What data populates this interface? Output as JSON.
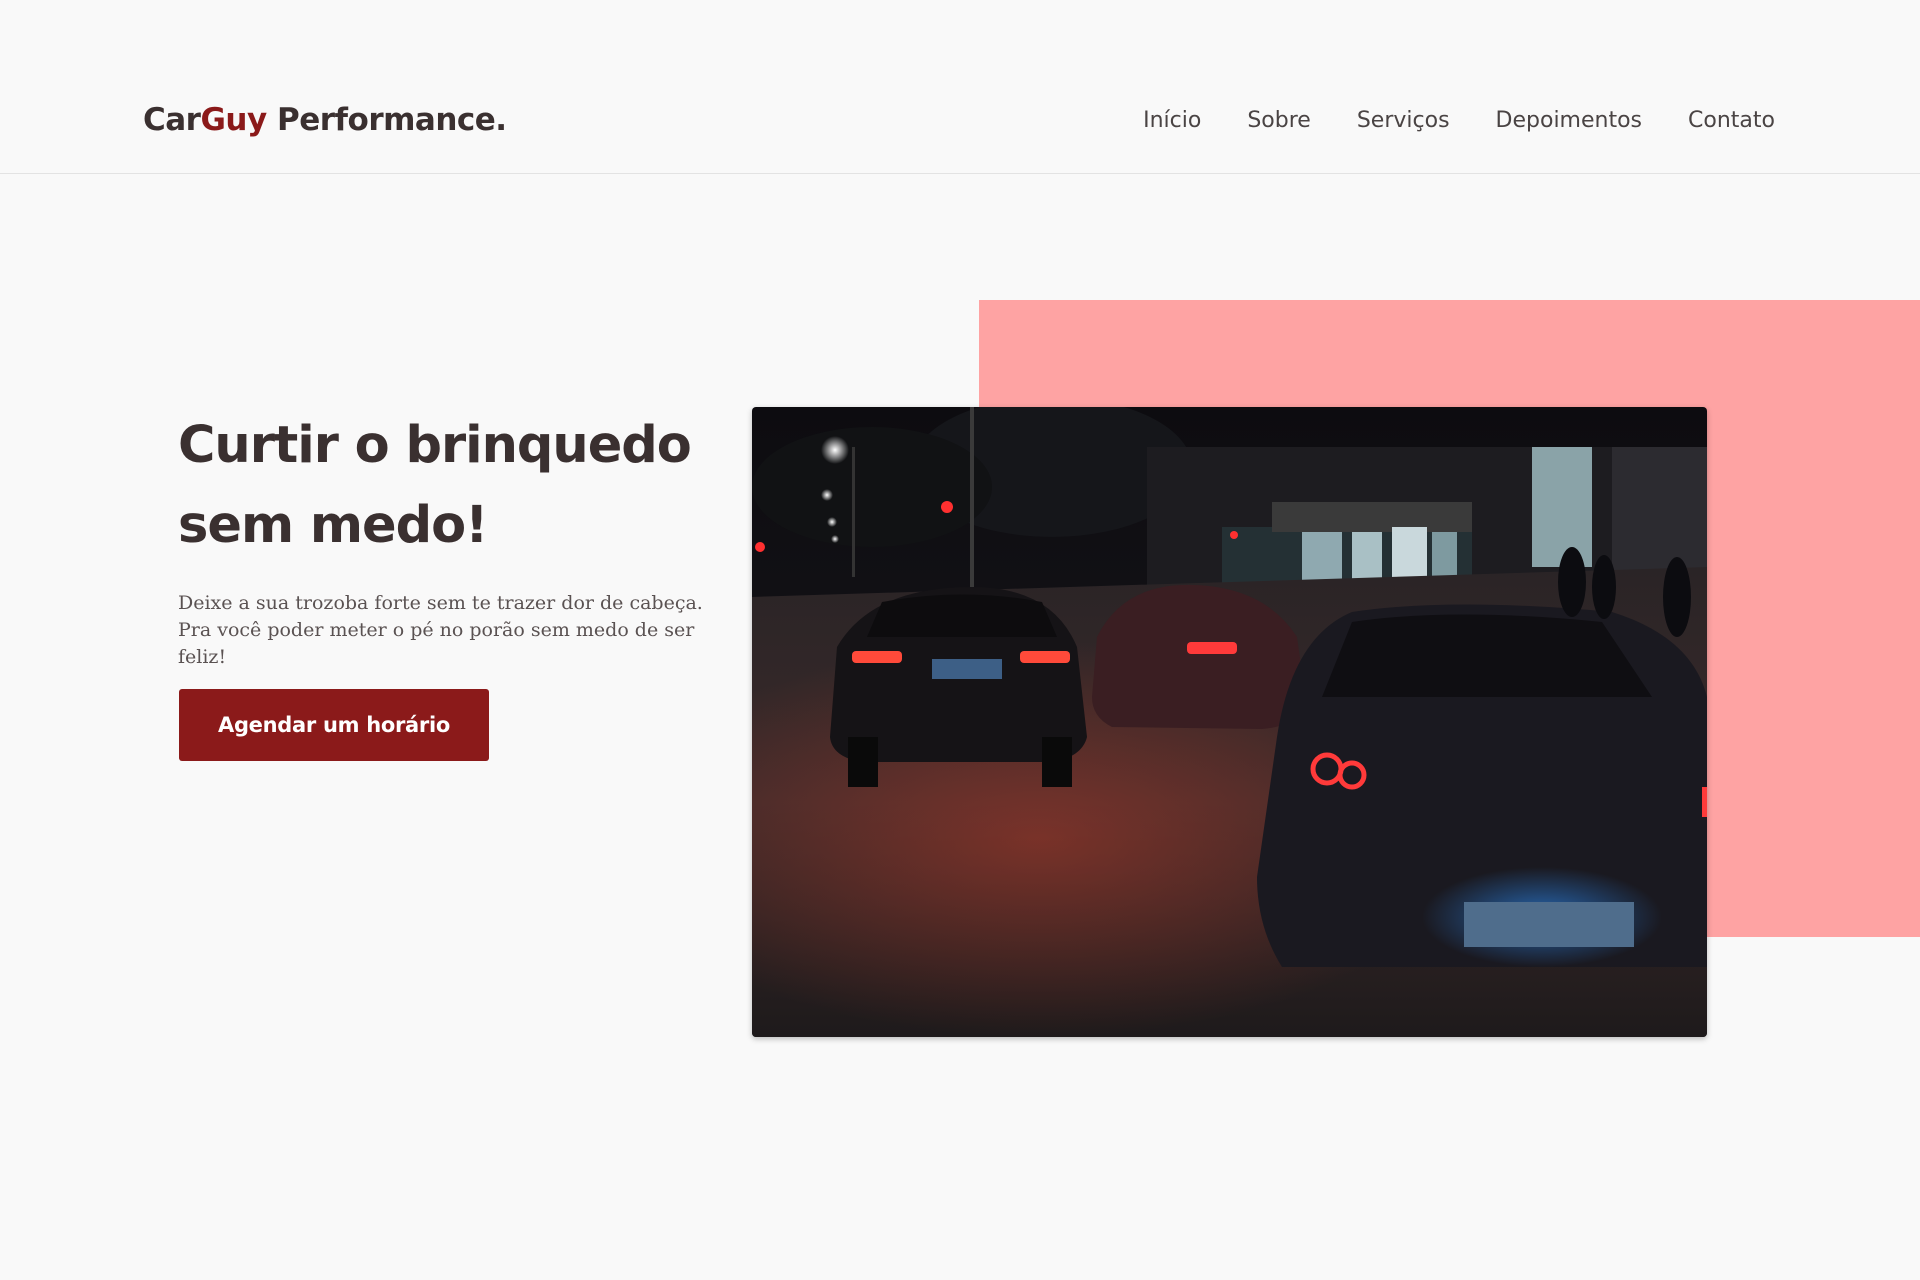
{
  "header": {
    "logo": {
      "part1": "Car",
      "part2": "Guy",
      "part3": " Performance."
    },
    "nav": [
      {
        "label": "Início"
      },
      {
        "label": "Sobre"
      },
      {
        "label": "Serviços"
      },
      {
        "label": "Depoimentos"
      },
      {
        "label": "Contato"
      }
    ]
  },
  "hero": {
    "title": "Curtir o brinquedo sem medo!",
    "text": "Deixe a sua trozoba forte sem te trazer dor de cabeça. Pra você poder meter o pé no porão sem medo de ser feliz!",
    "cta_label": "Agendar um horário",
    "image_icon": "night-street-cars-photo"
  },
  "colors": {
    "brand": "#8b1a1a",
    "text": "#3a3030",
    "pink_block": "#fea3a3",
    "background": "#f9f9f9"
  }
}
